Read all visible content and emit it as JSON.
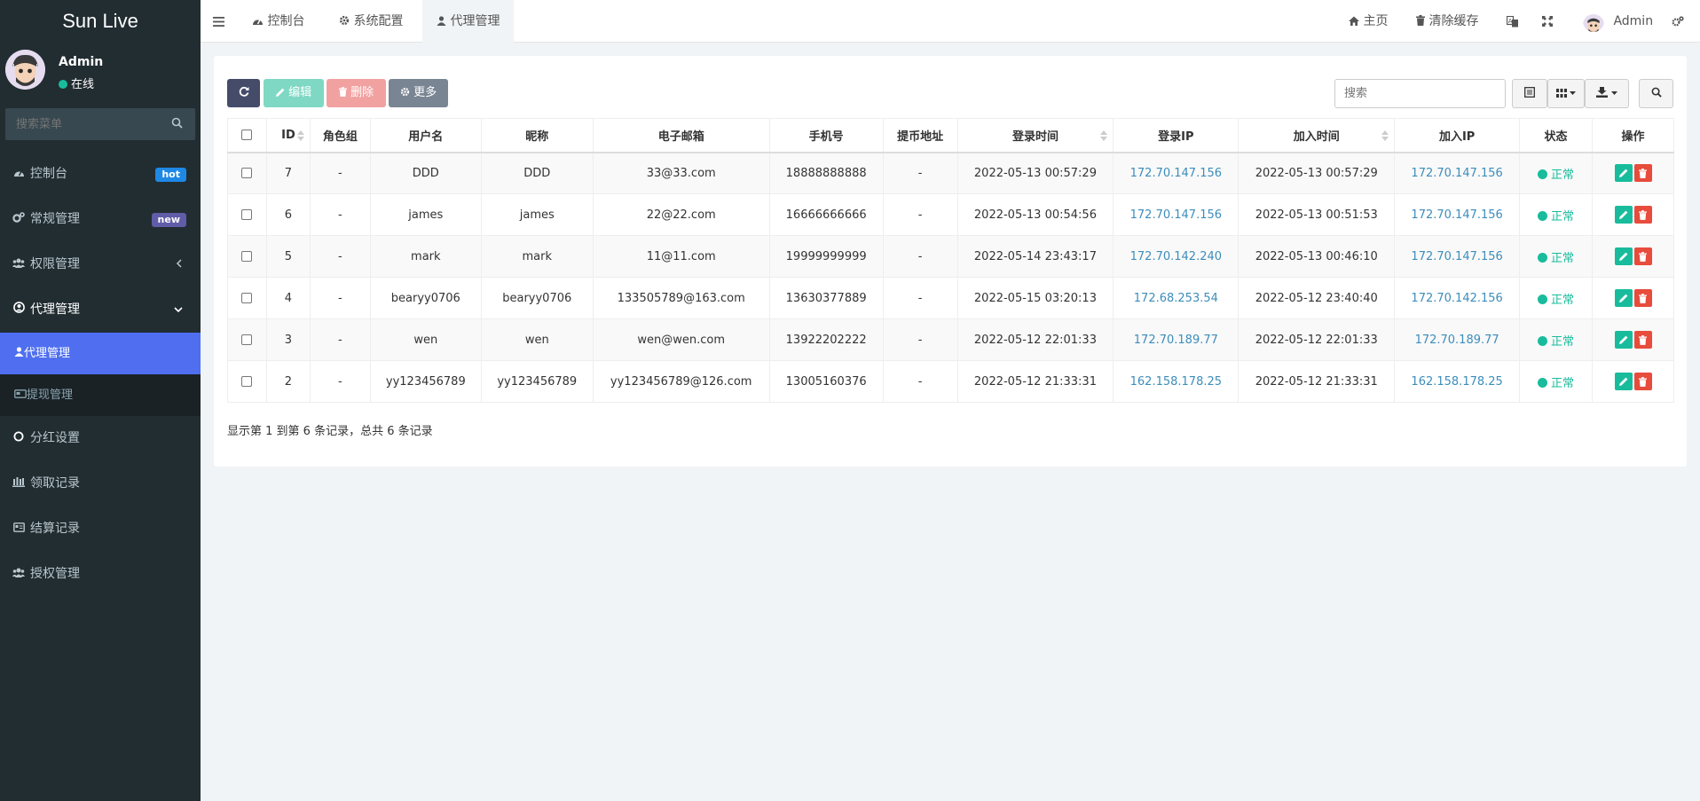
{
  "app": {
    "title": "Sun Live"
  },
  "user": {
    "name": "Admin",
    "status": "在线"
  },
  "sidebar": {
    "search_placeholder": "搜索菜单",
    "items": [
      {
        "label": "控制台",
        "icon": "dashboard-icon",
        "badge": "hot"
      },
      {
        "label": "常规管理",
        "icon": "cogs-icon",
        "badge": "new"
      },
      {
        "label": "权限管理",
        "icon": "group-icon"
      },
      {
        "label": "代理管理",
        "icon": "user-circle-icon"
      },
      {
        "label": "分红设置",
        "icon": "circle-icon"
      },
      {
        "label": "领取记录",
        "icon": "list-bars-icon"
      },
      {
        "label": "结算记录",
        "icon": "card-icon"
      },
      {
        "label": "授权管理",
        "icon": "group-icon"
      }
    ],
    "sub_items": [
      {
        "label": "代理管理",
        "icon": "user-icon"
      },
      {
        "label": "提现管理",
        "icon": "credit-card-icon"
      }
    ]
  },
  "topnav": {
    "tabs": [
      {
        "label": "控制台",
        "icon": "dashboard-icon"
      },
      {
        "label": "系统配置",
        "icon": "gear-icon"
      },
      {
        "label": "代理管理",
        "icon": "user-icon"
      }
    ],
    "home": "主页",
    "clear_cache": "清除缓存",
    "admin": "Admin"
  },
  "toolbar": {
    "edit": "编辑",
    "delete": "删除",
    "more": "更多",
    "search_placeholder": "搜索"
  },
  "table": {
    "headers": [
      "ID",
      "角色组",
      "用户名",
      "昵称",
      "电子邮箱",
      "手机号",
      "提币地址",
      "登录时间",
      "登录IP",
      "加入时间",
      "加入IP",
      "状态",
      "操作"
    ],
    "rows": [
      [
        "7",
        "-",
        "DDD",
        "DDD",
        "33@33.com",
        "18888888888",
        "-",
        "2022-05-13 00:57:29",
        "172.70.147.156",
        "2022-05-13 00:57:29",
        "172.70.147.156",
        "正常"
      ],
      [
        "6",
        "-",
        "james",
        "james",
        "22@22.com",
        "16666666666",
        "-",
        "2022-05-13 00:54:56",
        "172.70.147.156",
        "2022-05-13 00:51:53",
        "172.70.147.156",
        "正常"
      ],
      [
        "5",
        "-",
        "mark",
        "mark",
        "11@11.com",
        "19999999999",
        "-",
        "2022-05-14 23:43:17",
        "172.70.142.240",
        "2022-05-13 00:46:10",
        "172.70.147.156",
        "正常"
      ],
      [
        "4",
        "-",
        "bearyy0706",
        "bearyy0706",
        "133505789@163.com",
        "13630377889",
        "-",
        "2022-05-15 03:20:13",
        "172.68.253.54",
        "2022-05-12 23:40:40",
        "172.70.142.156",
        "正常"
      ],
      [
        "3",
        "-",
        "wen",
        "wen",
        "wen@wen.com",
        "13922202222",
        "-",
        "2022-05-12 22:01:33",
        "172.70.189.77",
        "2022-05-12 22:01:33",
        "172.70.189.77",
        "正常"
      ],
      [
        "2",
        "-",
        "yy123456789",
        "yy123456789",
        "yy123456789@126.com",
        "13005160376",
        "-",
        "2022-05-12 21:33:31",
        "162.158.178.25",
        "2022-05-12 21:33:31",
        "162.158.178.25",
        "正常"
      ]
    ]
  },
  "pagination": {
    "info": "显示第 1 到第 6 条记录，总共 6 条记录"
  },
  "colors": {
    "sidebar_bg": "#222d32",
    "active": "#4f6ff0",
    "success": "#18bc9c",
    "danger": "#e74c3c",
    "link": "#3c8dbc"
  }
}
